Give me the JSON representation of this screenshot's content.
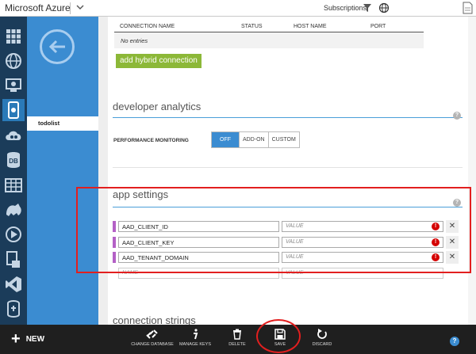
{
  "header": {
    "brand": "Microsoft Azure",
    "subscriptions_label": "Subscriptions"
  },
  "nav": {
    "icons": [
      "all-items-icon",
      "web-apps-icon",
      "virtual-machines-icon",
      "mobile-services-icon",
      "cloud-services-icon",
      "sql-databases-icon",
      "storage-icon",
      "hdinsight-icon",
      "media-services-icon",
      "service-bus-icon",
      "visual-studio-icon",
      "biztalk-icon"
    ],
    "selected_item": "todolist"
  },
  "connections": {
    "columns": [
      "CONNECTION NAME",
      "STATUS",
      "HOST NAME",
      "PORT"
    ],
    "empty_text": "No entries",
    "add_button": "add hybrid connection"
  },
  "developer_analytics": {
    "title": "developer analytics",
    "perf_label": "PERFORMANCE MONITORING",
    "options": [
      "OFF",
      "ADD-ON",
      "CUSTOM"
    ],
    "selected": "OFF"
  },
  "app_settings": {
    "title": "app settings",
    "rows": [
      {
        "name": "AAD_CLIENT_ID",
        "value_placeholder": "VALUE"
      },
      {
        "name": "AAD_CLIENT_KEY",
        "value_placeholder": "VALUE"
      },
      {
        "name": "AAD_TENANT_DOMAIN",
        "value_placeholder": "VALUE"
      }
    ],
    "new_name_placeholder": "NAME",
    "new_value_placeholder": "VALUE"
  },
  "connection_strings": {
    "title": "connection strings"
  },
  "bottom": {
    "new_label": "NEW",
    "commands": [
      "CHANGE DATABASE",
      "MANAGE KEYS",
      "DELETE",
      "SAVE",
      "DISCARD"
    ]
  },
  "colors": {
    "nav_bg": "#1b3c5a",
    "panel_blue": "#3b8cd1",
    "accent_green": "#8cb838",
    "setting_bar": "#b461c6",
    "annotation_red": "#e21f1f"
  }
}
